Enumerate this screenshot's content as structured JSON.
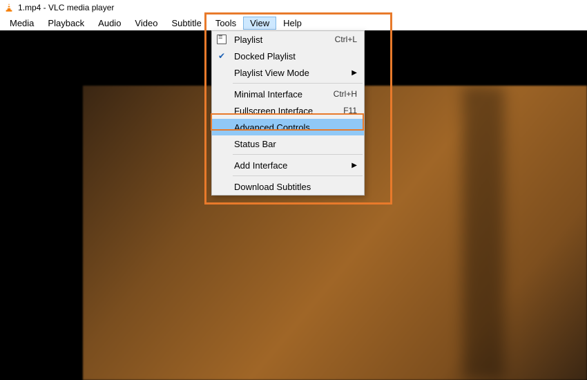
{
  "title": "1.mp4 - VLC media player",
  "menubar": {
    "items": [
      "Media",
      "Playback",
      "Audio",
      "Video",
      "Subtitle",
      "Tools",
      "View",
      "Help"
    ],
    "active_index": 6
  },
  "dropdown": {
    "items": [
      {
        "label": "Playlist",
        "shortcut": "Ctrl+L",
        "icon": "playlist"
      },
      {
        "label": "Docked Playlist",
        "icon": "check"
      },
      {
        "label": "Playlist View Mode",
        "submenu": true
      },
      {
        "type": "separator"
      },
      {
        "label": "Minimal Interface",
        "shortcut": "Ctrl+H"
      },
      {
        "label": "Fullscreen Interface",
        "shortcut": "F11"
      },
      {
        "label": "Advanced Controls",
        "highlight": true
      },
      {
        "label": "Status Bar"
      },
      {
        "type": "separator"
      },
      {
        "label": "Add Interface",
        "submenu": true
      },
      {
        "type": "separator"
      },
      {
        "label": "Download Subtitles"
      }
    ]
  },
  "annotation": {
    "color": "#e87a2b"
  }
}
